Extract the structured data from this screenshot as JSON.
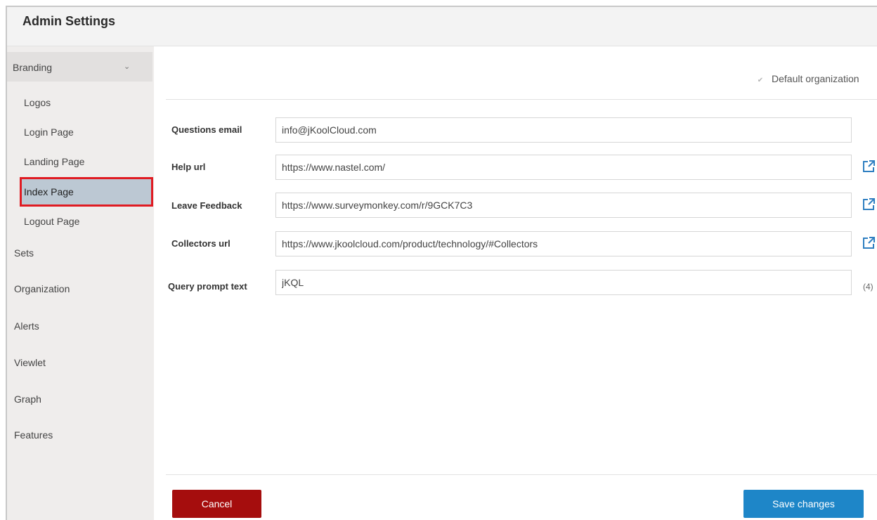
{
  "header": {
    "title": "Admin Settings"
  },
  "sidebar": {
    "branding": {
      "label": "Branding"
    },
    "branding_items": [
      {
        "label": "Logos"
      },
      {
        "label": "Login Page"
      },
      {
        "label": "Landing Page"
      },
      {
        "label": "Index Page"
      },
      {
        "label": "Logout Page"
      }
    ],
    "sections": [
      {
        "label": "Sets"
      },
      {
        "label": "Organization"
      },
      {
        "label": "Alerts"
      },
      {
        "label": "Viewlet"
      },
      {
        "label": "Graph"
      },
      {
        "label": "Features"
      }
    ]
  },
  "main": {
    "default_org_label": "Default organization",
    "default_org_checked": true,
    "fields": [
      {
        "label": "Questions email",
        "value": "info@jKoolCloud.com"
      },
      {
        "label": "Help url",
        "value": "https://www.nastel.com/"
      },
      {
        "label": "Leave Feedback",
        "value": "https://www.surveymonkey.com/r/9GCK7C3"
      },
      {
        "label": "Collectors url",
        "value": "https://www.jkoolcloud.com/product/technology/#Collectors"
      },
      {
        "label": "Query prompt text",
        "value": "jKQL",
        "count": "(4)"
      }
    ]
  },
  "buttons": {
    "cancel": "Cancel",
    "save": "Save changes"
  },
  "colors": {
    "cancel_bg": "#a50d0d",
    "save_bg": "#1e86c8",
    "highlight_border": "#e01b22",
    "selected_bg": "#bcc8d3"
  },
  "icons": {
    "external_link": "external-link-icon",
    "chevron": "chevron-down-icon"
  }
}
